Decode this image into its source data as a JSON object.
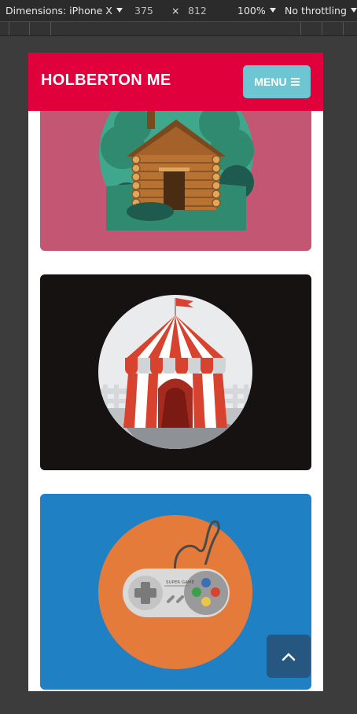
{
  "devtools": {
    "dimensions_label": "Dimensions: iPhone X",
    "width": "375",
    "times": "×",
    "height": "812",
    "zoom": "100%",
    "throttling": "No throttling"
  },
  "header": {
    "brand": "HOLBERTON ME",
    "menu_label": "MENU"
  },
  "cards": [
    {
      "subject": "log-cabin",
      "background": "#c35672"
    },
    {
      "subject": "circus-tent",
      "background": "#171212"
    },
    {
      "subject": "game-controller",
      "background": "#1f80c4"
    }
  ],
  "colors": {
    "header": "#e0003b",
    "menu_button": "#6ec6d3",
    "back_to_top": "#265781"
  },
  "controller_text": "SUPER GAME",
  "icons": [
    "hamburger-icon",
    "chevron-up-icon"
  ]
}
